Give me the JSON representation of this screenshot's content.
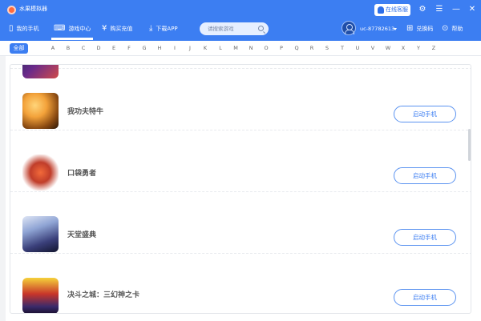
{
  "app": {
    "title": "水果模拟器"
  },
  "titlebar": {
    "support_label": "在线客服"
  },
  "nav": {
    "items": [
      {
        "label": "我的手机",
        "icon": "phone-icon"
      },
      {
        "label": "游戏中心",
        "icon": "gamepad-icon"
      },
      {
        "label": "购买充值",
        "icon": "yen-coin-icon"
      },
      {
        "label": "下载APP",
        "icon": "download-icon"
      }
    ],
    "active_index": 1
  },
  "search": {
    "placeholder": "请搜索游戏"
  },
  "user": {
    "name": "uc-87782613",
    "redeem_label": "兑换码",
    "help_label": "帮助"
  },
  "alphabet": {
    "all_label": "全部",
    "letters": [
      "A",
      "B",
      "C",
      "D",
      "E",
      "F",
      "G",
      "H",
      "I",
      "J",
      "K",
      "L",
      "M",
      "N",
      "O",
      "P",
      "Q",
      "R",
      "S",
      "T",
      "U",
      "V",
      "W",
      "X",
      "Y",
      "Z"
    ]
  },
  "games": [
    {
      "name": "我功夫特牛",
      "action": "启动手机"
    },
    {
      "name": "口袋勇者",
      "action": "启动手机"
    },
    {
      "name": "天堂盛典",
      "action": "启动手机"
    },
    {
      "name": "决斗之城：三幻神之卡",
      "action": "启动手机"
    }
  ],
  "colors": {
    "accent": "#3c7ef2",
    "background": "#ffffff"
  }
}
